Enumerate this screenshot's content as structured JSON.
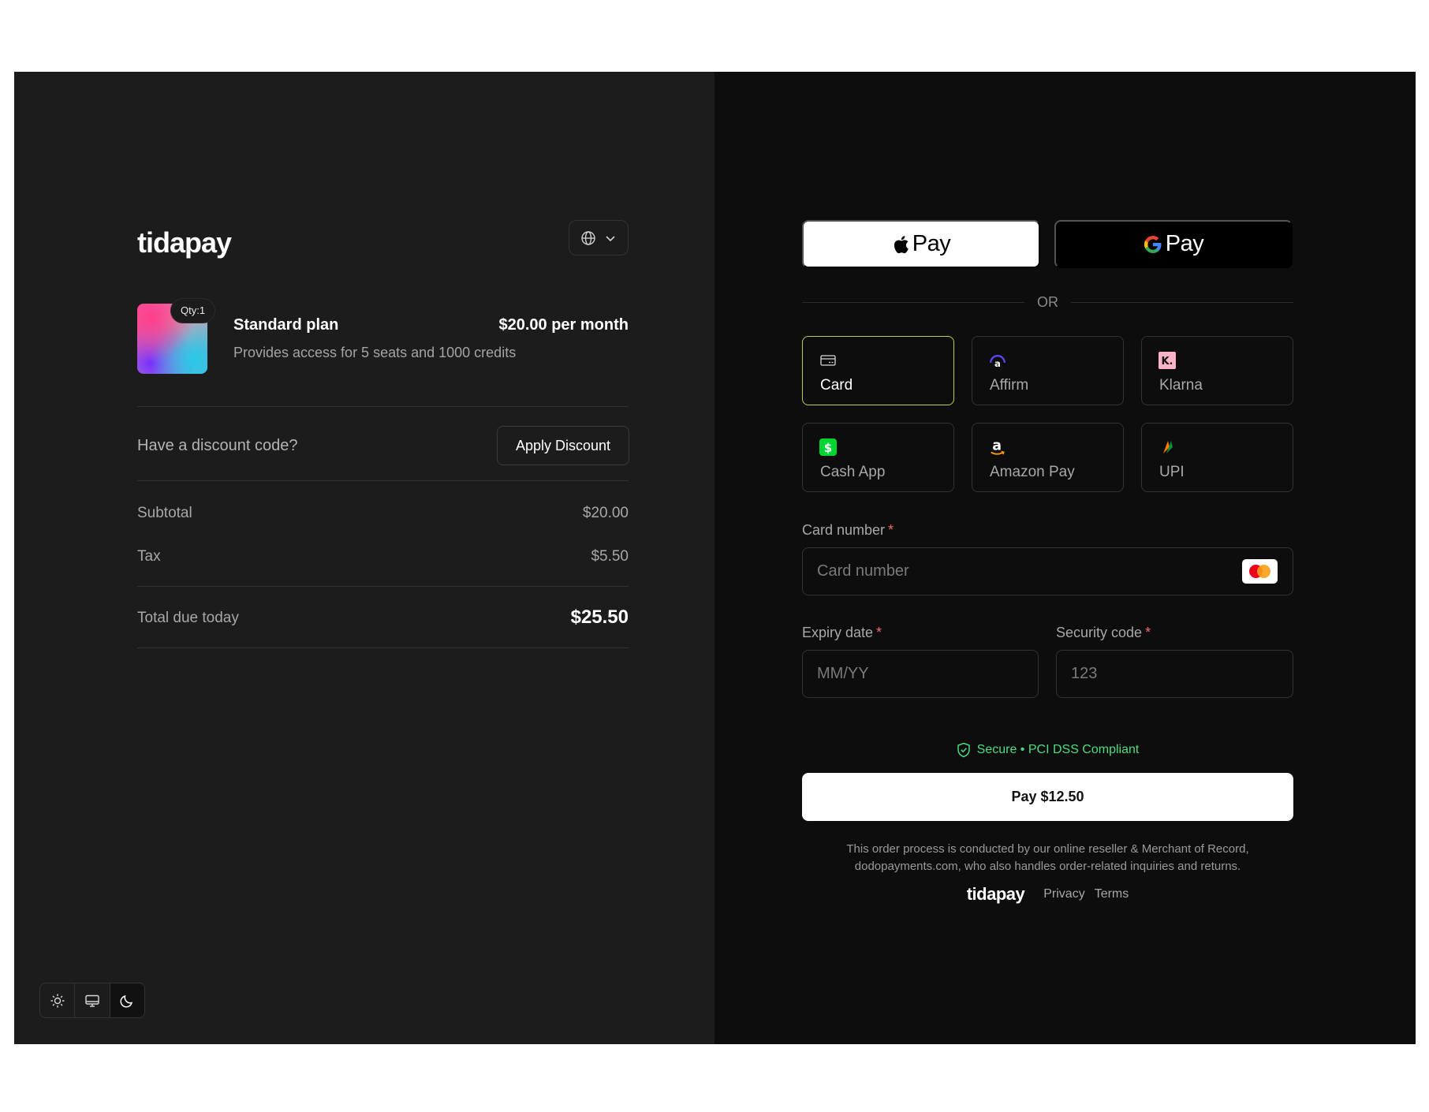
{
  "brand": {
    "logo": "tidapay"
  },
  "product": {
    "qty_badge": "Qty:1",
    "name": "Standard plan",
    "price": "$20.00 per month",
    "description": "Provides access for 5 seats and 1000 credits"
  },
  "discount": {
    "prompt": "Have a discount code?",
    "button": "Apply Discount"
  },
  "summary": {
    "subtotal_label": "Subtotal",
    "subtotal_value": "$20.00",
    "tax_label": "Tax",
    "tax_value": "$5.50",
    "total_label": "Total due today",
    "total_value": "$25.50"
  },
  "wallets": {
    "apple_pay": "Pay",
    "google_pay": "Pay"
  },
  "divider_text": "OR",
  "payment_methods": [
    {
      "label": "Card",
      "icon": "card-icon",
      "selected": true
    },
    {
      "label": "Affirm",
      "icon": "affirm-icon",
      "selected": false
    },
    {
      "label": "Klarna",
      "icon": "klarna-icon",
      "selected": false
    },
    {
      "label": "Cash App",
      "icon": "cashapp-icon",
      "selected": false
    },
    {
      "label": "Amazon Pay",
      "icon": "amazon-icon",
      "selected": false
    },
    {
      "label": "UPI",
      "icon": "upi-icon",
      "selected": false
    }
  ],
  "card_form": {
    "card_number_label": "Card number",
    "card_number_placeholder": "Card number",
    "expiry_label": "Expiry date",
    "expiry_placeholder": "MM/YY",
    "security_label": "Security code",
    "security_placeholder": "123",
    "required_mark": "*"
  },
  "secure_text": "Secure • PCI DSS Compliant",
  "pay_button": "Pay $12.50",
  "legal_line1": "This order process is conducted by our online reseller & Merchant of Record,",
  "legal_line2": "dodopayments.com, who also handles order-related inquiries and returns.",
  "footer": {
    "logo": "tidapay",
    "privacy": "Privacy",
    "terms": "Terms"
  },
  "colors": {
    "left_bg": "#1c1c1c",
    "right_bg": "#0d0d0d",
    "selected_border": "#b5d33e",
    "secure_green": "#4ade80",
    "required_red": "#f06a6a"
  }
}
